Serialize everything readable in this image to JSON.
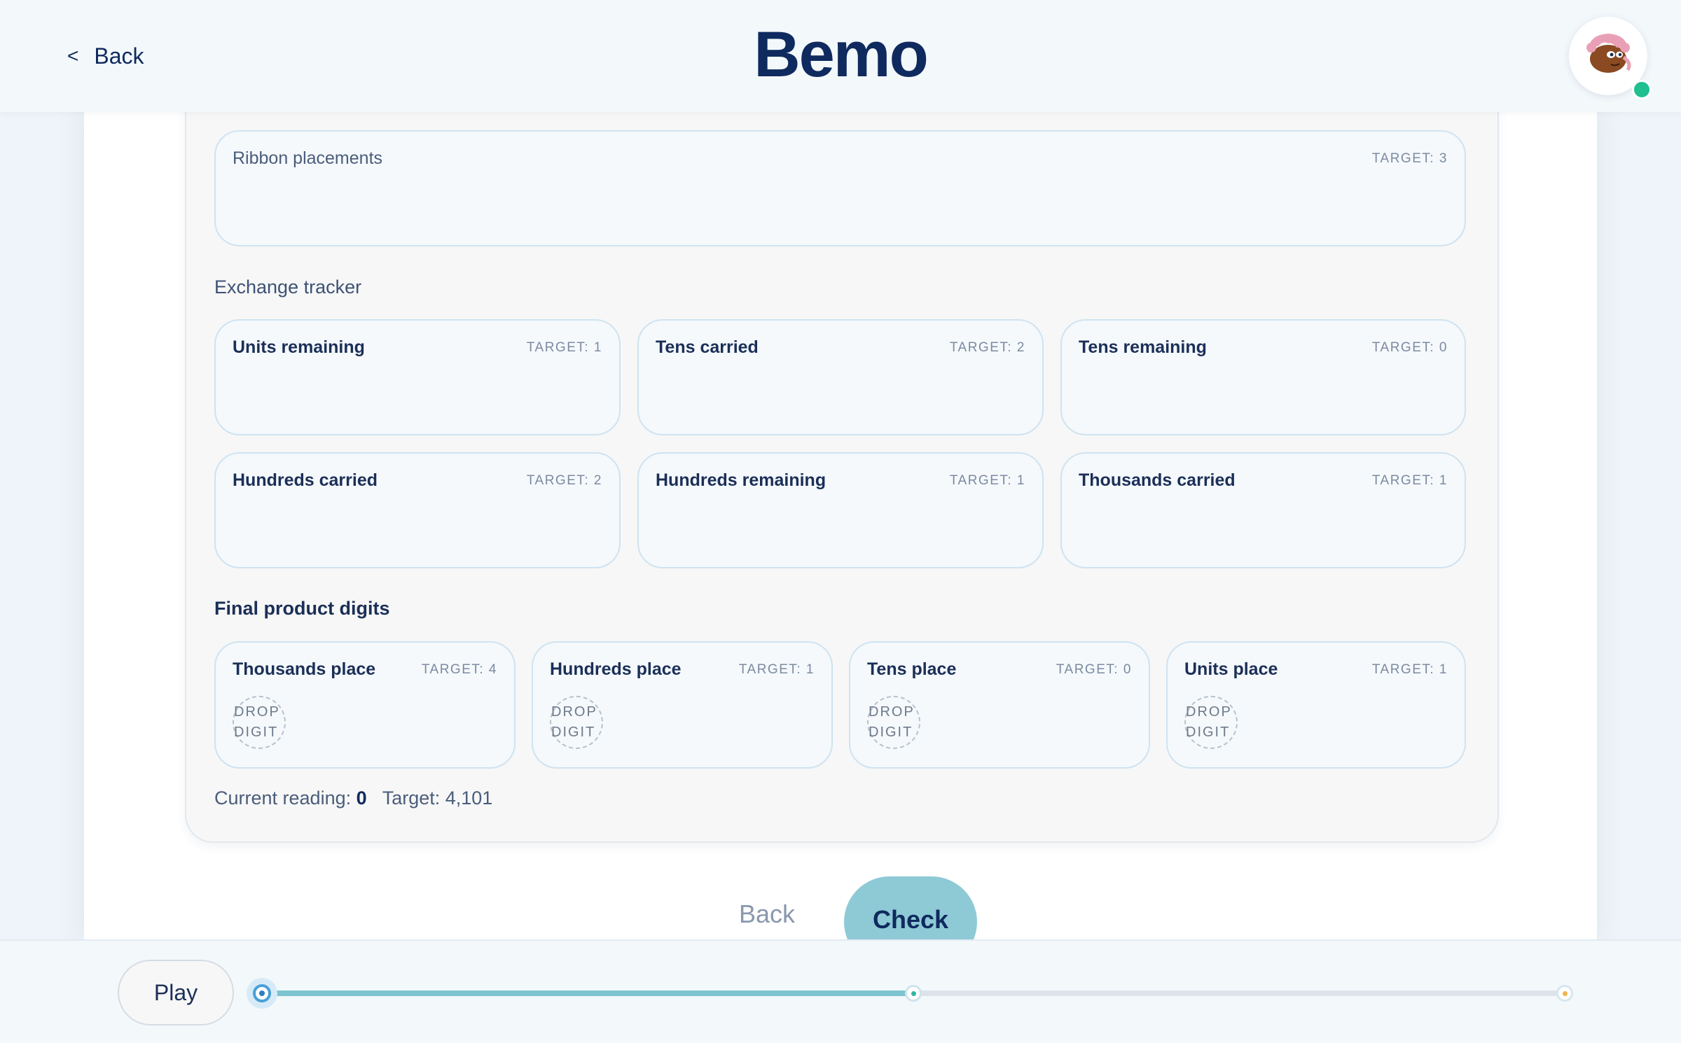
{
  "header": {
    "back_label": "Back",
    "title": "Bemo",
    "avatar_status_color": "#1fbf8f"
  },
  "ribbon": {
    "label": "Ribbon placements",
    "target": "TARGET: 3"
  },
  "exchange": {
    "heading": "Exchange tracker",
    "slots": [
      {
        "label": "Units remaining",
        "target": "TARGET: 1"
      },
      {
        "label": "Tens carried",
        "target": "TARGET: 2"
      },
      {
        "label": "Tens remaining",
        "target": "TARGET: 0"
      },
      {
        "label": "Hundreds carried",
        "target": "TARGET: 2"
      },
      {
        "label": "Hundreds remaining",
        "target": "TARGET: 1"
      },
      {
        "label": "Thousands carried",
        "target": "TARGET: 1"
      }
    ]
  },
  "final": {
    "heading": "Final product digits",
    "drop_text": "DROP\nDIGIT",
    "slots": [
      {
        "label": "Thousands place",
        "target": "TARGET: 4"
      },
      {
        "label": "Hundreds place",
        "target": "TARGET: 1"
      },
      {
        "label": "Tens place",
        "target": "TARGET: 0"
      },
      {
        "label": "Units place",
        "target": "TARGET: 1"
      }
    ]
  },
  "reading": {
    "current_label": "Current reading:",
    "current_value": "0",
    "target_label": "Target: 4,101"
  },
  "actions": {
    "back_label": "Back",
    "check_label": "Check",
    "check_color": "#8ecad6"
  },
  "timeline": {
    "play_label": "Play",
    "progress": 0.5,
    "markers": [
      "current",
      "checkpoint",
      "end"
    ],
    "accent_color": "#7cc4cf"
  }
}
